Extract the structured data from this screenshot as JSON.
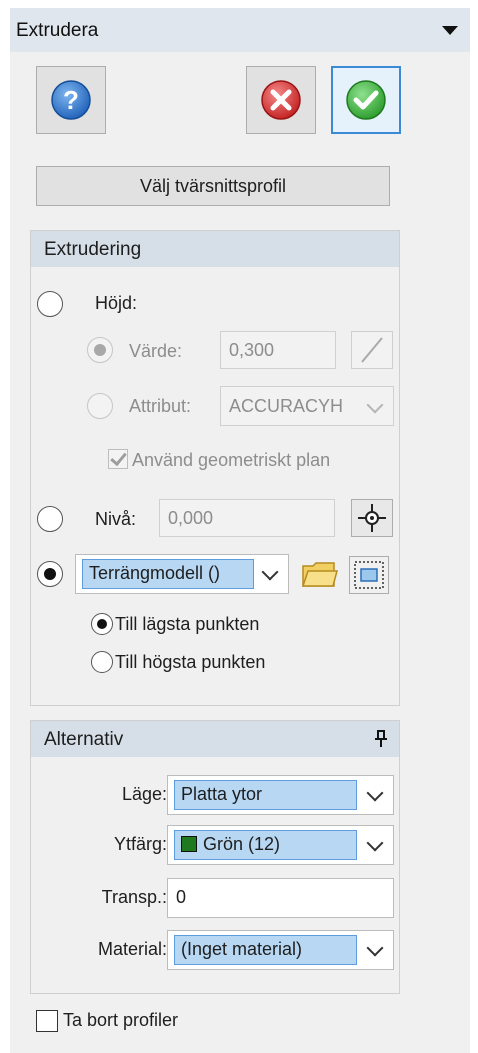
{
  "panel": {
    "title": "Extrudera",
    "colors": {
      "header_bg": "#dfe6ee",
      "group_header_bg": "#d6dfe8",
      "selection_bg": "#b7d7f3",
      "accent": "#3c8ad6"
    }
  },
  "toolbar": {
    "help_icon": "help-icon",
    "cancel_icon": "cancel-icon",
    "ok_icon": "ok-check-icon"
  },
  "select_profile_button": "Välj tvärsnittsprofil",
  "extrusion": {
    "header": "Extrudering",
    "height_label": "Höjd:",
    "value_label": "Värde:",
    "value": "0,300",
    "attribute_label": "Attribut:",
    "attribute_value": "ACCURACYH",
    "use_plane_label": "Använd geometriskt plan",
    "level_label": "Nivå:",
    "level_value": "0,000",
    "terrain_model": "Terrängmodell ()",
    "lowest_point": "Till lägsta punkten",
    "highest_point": "Till högsta punkten"
  },
  "alternatives": {
    "header": "Alternativ",
    "pin_icon": "pin-icon",
    "mode_label": "Läge:",
    "mode_value": "Platta ytor",
    "surface_color_label": "Ytfärg:",
    "surface_color_value": "Grön (12)",
    "surface_color_hex": "#1f7a1f",
    "transp_label": "Transp.:",
    "transp_value": "0",
    "material_label": "Material:",
    "material_value": "(Inget material)"
  },
  "remove_profiles_label": "Ta bort profiler"
}
